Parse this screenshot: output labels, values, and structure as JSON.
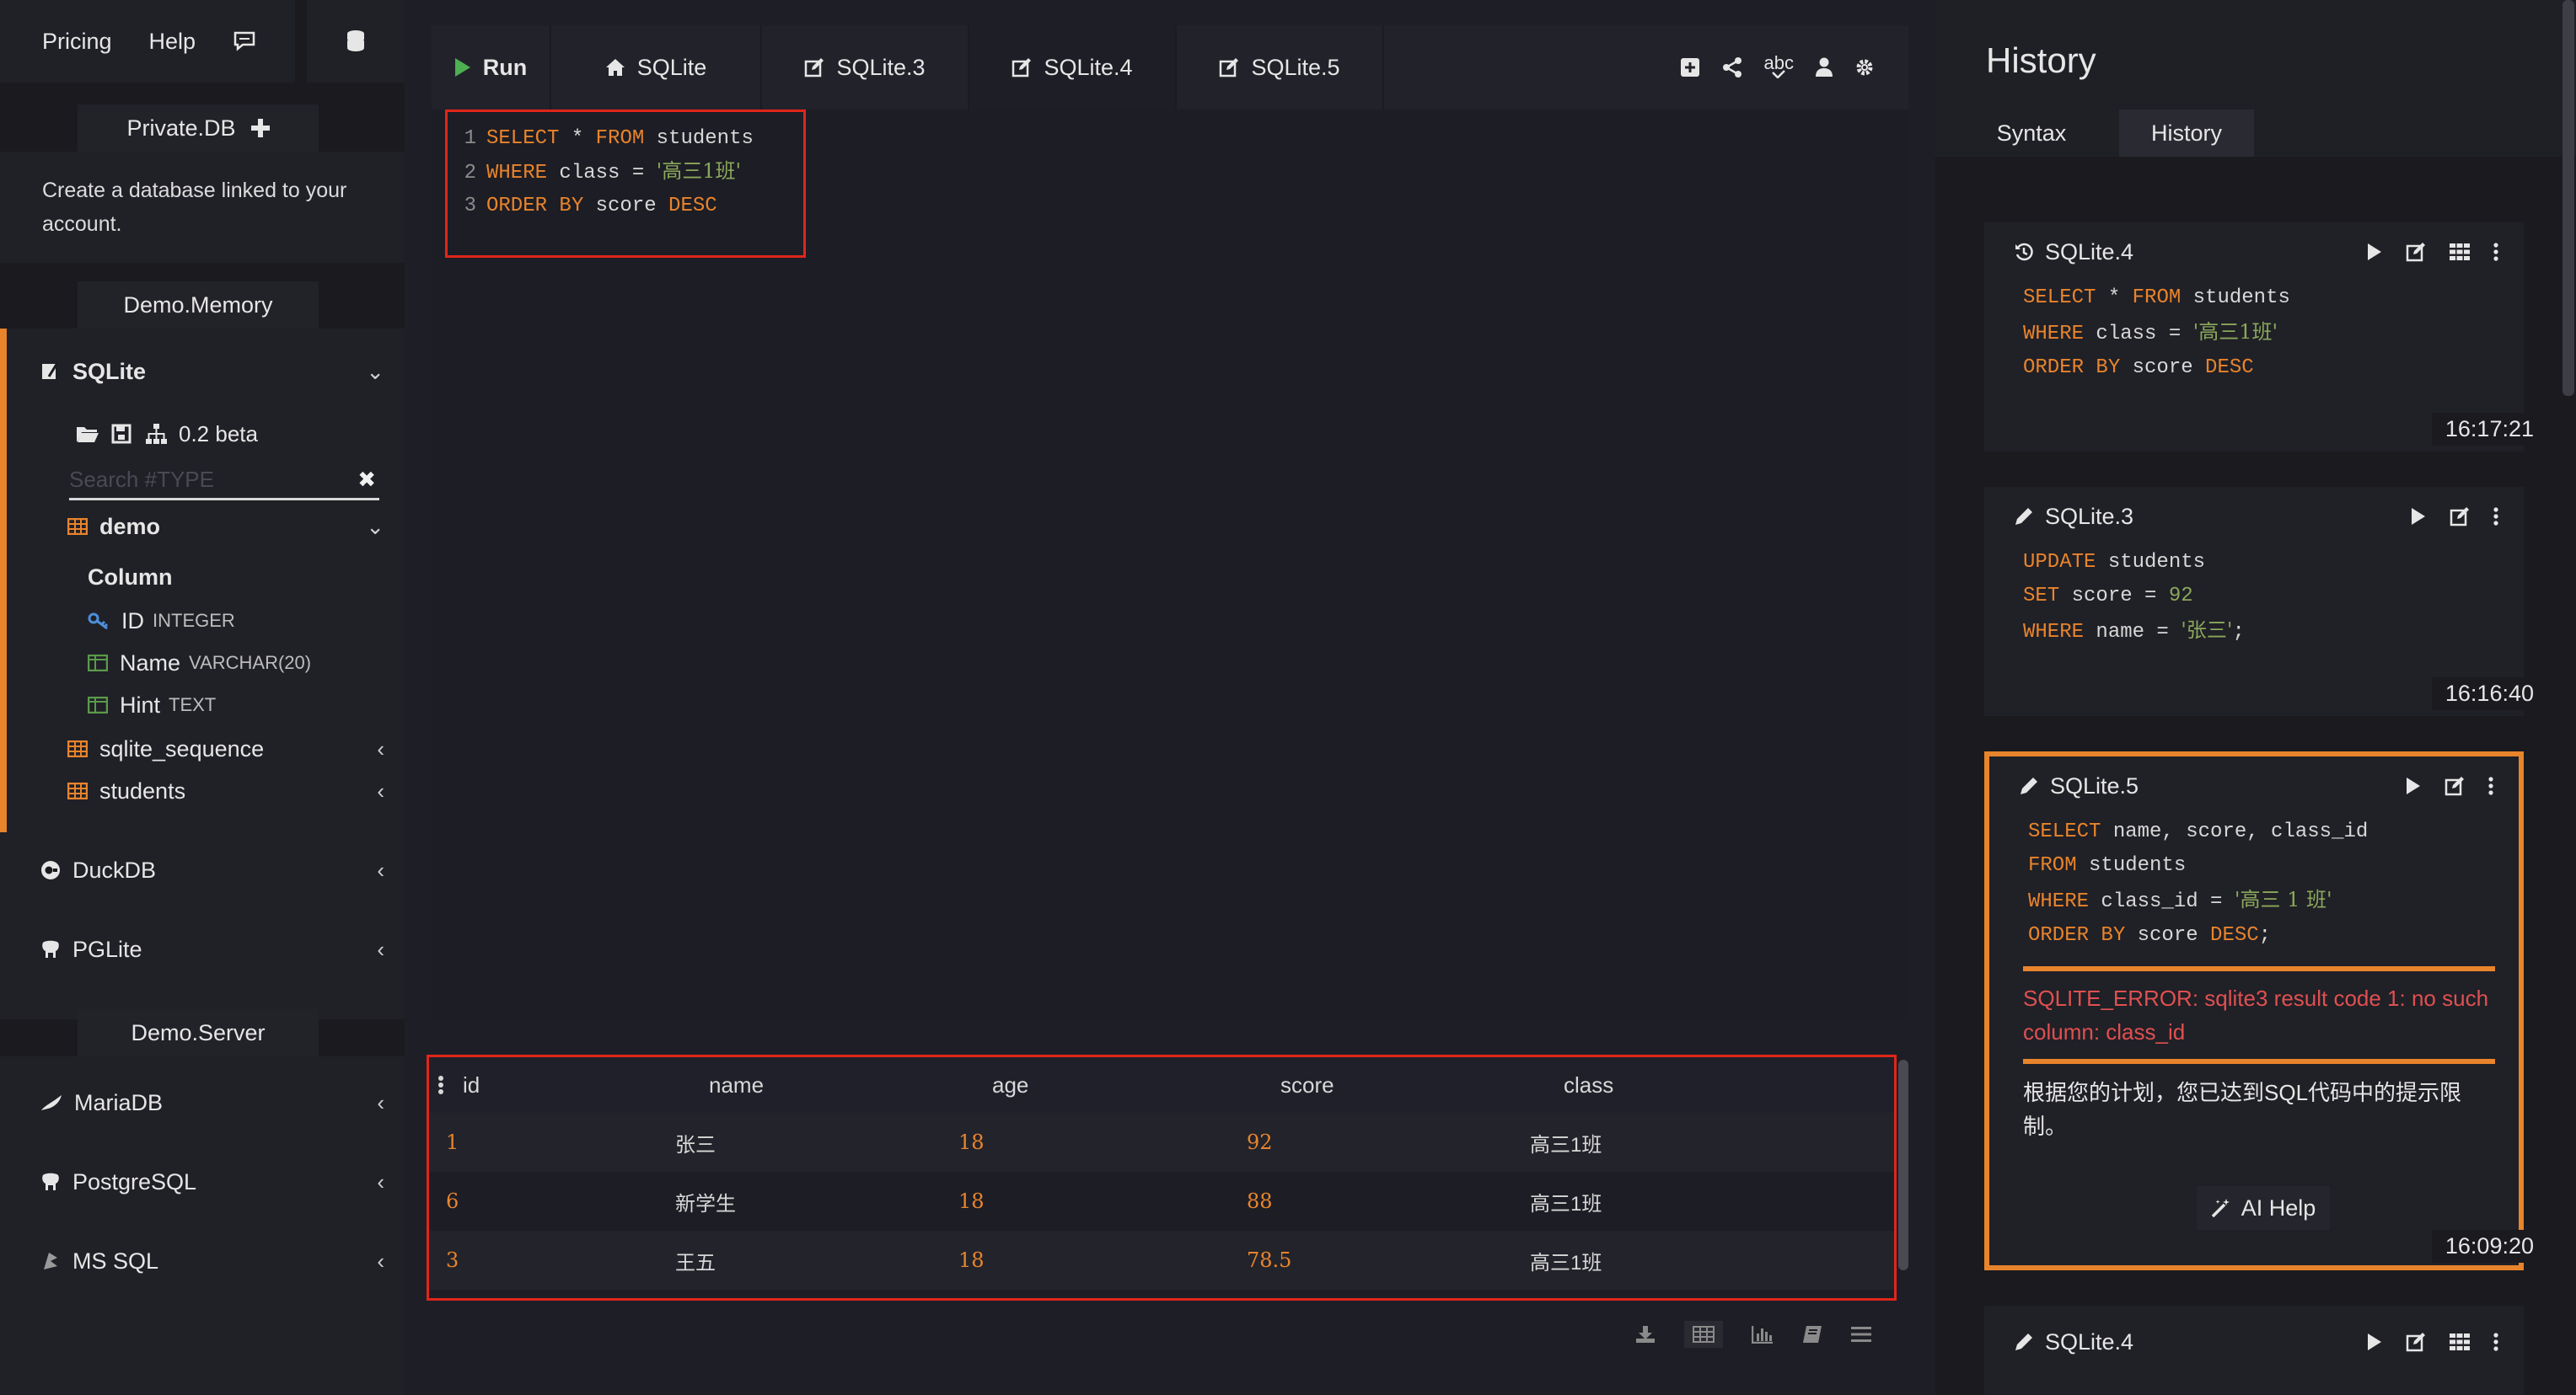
{
  "colors": {
    "accent": "#e8842c",
    "highlight_box": "#e0261a",
    "error": "#e05050",
    "keyword": "#e8842c",
    "string": "#8aa85a"
  },
  "sidebar": {
    "top_links": [
      "Pricing",
      "Help"
    ],
    "private_section": {
      "title": "Private.DB",
      "description": "Create a database linked to your account."
    },
    "demo_memory": {
      "title": "Demo.Memory",
      "sqlite": {
        "label": "SQLite",
        "version": "0.2 beta",
        "search_placeholder": "Search #TYPE",
        "tables": [
          {
            "name": "demo",
            "columns_header": "Column",
            "columns": [
              {
                "name": "ID",
                "type": "INTEGER"
              },
              {
                "name": "Name",
                "type": "VARCHAR(20)"
              },
              {
                "name": "Hint",
                "type": "TEXT"
              }
            ]
          },
          {
            "name": "sqlite_sequence"
          },
          {
            "name": "students"
          }
        ]
      },
      "duckdb": "DuckDB",
      "pglite": "PGLite"
    },
    "demo_server": {
      "title": "Demo.Server",
      "items": [
        "MariaDB",
        "PostgreSQL",
        "MS SQL"
      ]
    }
  },
  "main": {
    "tabs": {
      "run": "Run",
      "list": [
        "SQLite",
        "SQLite.3",
        "SQLite.4",
        "SQLite.5"
      ]
    },
    "tool_spell": "abc",
    "editor": {
      "lines": [
        {
          "no": "1",
          "parts": [
            [
              "kw",
              "SELECT"
            ],
            [
              "tx",
              " * "
            ],
            [
              "kw",
              "FROM"
            ],
            [
              "tx",
              " students"
            ]
          ]
        },
        {
          "no": "2",
          "parts": [
            [
              "kw",
              "WHERE"
            ],
            [
              "tx",
              " class = "
            ],
            [
              "str",
              "'高三1班'"
            ]
          ]
        },
        {
          "no": "3",
          "parts": [
            [
              "kw",
              "ORDER BY"
            ],
            [
              "tx",
              " score "
            ],
            [
              "kw",
              "DESC"
            ]
          ]
        }
      ]
    },
    "result": {
      "columns": [
        "id",
        "name",
        "age",
        "score",
        "class"
      ],
      "rows": [
        [
          "1",
          "张三",
          "18",
          "92",
          "高三1班"
        ],
        [
          "6",
          "新学生",
          "18",
          "88",
          "高三1班"
        ],
        [
          "3",
          "王五",
          "18",
          "78.5",
          "高三1班"
        ]
      ]
    }
  },
  "history": {
    "title": "History",
    "tabs": [
      "Syntax",
      "History"
    ],
    "cards": [
      {
        "tab": "SQLite.4",
        "time": "16:17:21",
        "lines": [
          [
            [
              "kw",
              "SELECT"
            ],
            [
              "tx",
              " * "
            ],
            [
              "kw",
              "FROM"
            ],
            [
              "tx",
              " students"
            ]
          ],
          [
            [
              "kw",
              "WHERE"
            ],
            [
              "tx",
              " class = "
            ],
            [
              "str",
              "'高三1班'"
            ]
          ],
          [
            [
              "kw",
              "ORDER BY"
            ],
            [
              "tx",
              " score "
            ],
            [
              "kw",
              "DESC"
            ]
          ]
        ]
      },
      {
        "tab": "SQLite.3",
        "time": "16:16:40",
        "lines": [
          [
            [
              "kw",
              "UPDATE"
            ],
            [
              "tx",
              " students"
            ]
          ],
          [
            [
              "kw",
              "SET"
            ],
            [
              "tx",
              " score = "
            ],
            [
              "str",
              "92"
            ]
          ],
          [
            [
              "kw",
              "WHERE"
            ],
            [
              "tx",
              " name = "
            ],
            [
              "str",
              "'张三'"
            ],
            [
              "tx",
              ";"
            ]
          ]
        ]
      },
      {
        "tab": "SQLite.5",
        "time": "16:09:20",
        "lines": [
          [
            [
              "kw",
              "SELECT"
            ],
            [
              "tx",
              " name, score, class_id"
            ]
          ],
          [
            [
              "kw",
              "FROM"
            ],
            [
              "tx",
              " students"
            ]
          ],
          [
            [
              "kw",
              "WHERE"
            ],
            [
              "tx",
              " class_id = "
            ],
            [
              "str",
              "'高三 1 班'"
            ]
          ],
          [
            [
              "kw",
              "ORDER BY"
            ],
            [
              "tx",
              " score "
            ],
            [
              "kw",
              "DESC"
            ],
            [
              "tx",
              ";"
            ]
          ]
        ],
        "error": "SQLITE_ERROR: sqlite3 result code 1: no such column: class_id",
        "hint": "根据您的计划，您已达到SQL代码中的提示限制。",
        "ai_button": "AI Help"
      },
      {
        "tab": "SQLite.4"
      }
    ]
  }
}
